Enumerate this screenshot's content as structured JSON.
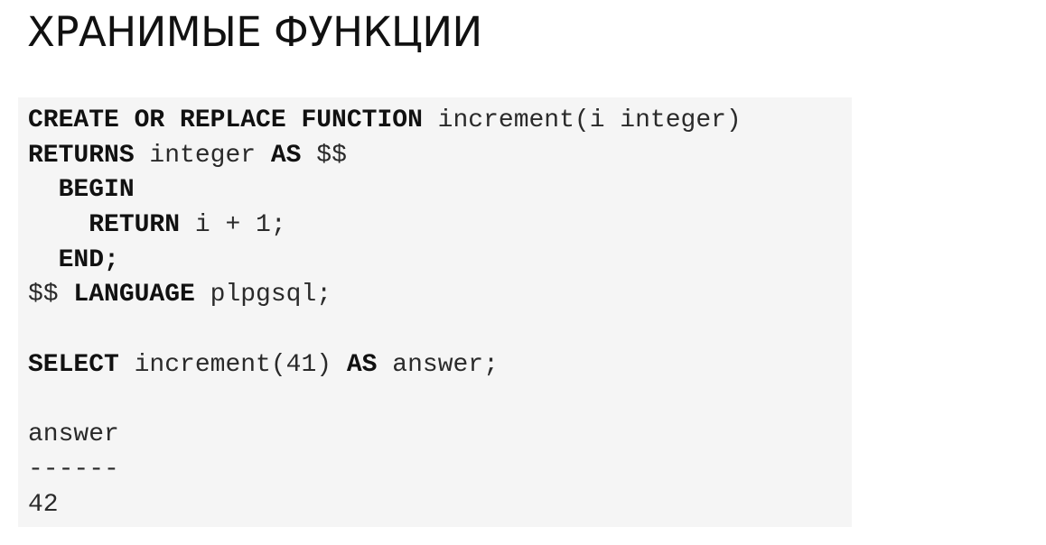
{
  "slide": {
    "title": "ХРАНИМЫЕ ФУНКЦИИ"
  },
  "code": {
    "lines": [
      [
        {
          "t": "CREATE OR REPLACE FUNCTION",
          "kw": true
        },
        {
          "t": " increment(i integer)",
          "kw": false
        }
      ],
      [
        {
          "t": "RETURNS",
          "kw": true
        },
        {
          "t": " integer ",
          "kw": false
        },
        {
          "t": "AS",
          "kw": true
        },
        {
          "t": " $$",
          "kw": false
        }
      ],
      [
        {
          "t": "  ",
          "kw": false
        },
        {
          "t": "BEGIN",
          "kw": true
        }
      ],
      [
        {
          "t": "    ",
          "kw": false
        },
        {
          "t": "RETURN",
          "kw": true
        },
        {
          "t": " i + 1;",
          "kw": false
        }
      ],
      [
        {
          "t": "  ",
          "kw": false
        },
        {
          "t": "END;",
          "kw": true
        }
      ],
      [
        {
          "t": "$$ ",
          "kw": false
        },
        {
          "t": "LANGUAGE",
          "kw": true
        },
        {
          "t": " plpgsql;",
          "kw": false
        }
      ],
      [],
      [
        {
          "t": "SELECT",
          "kw": true
        },
        {
          "t": " increment(41) ",
          "kw": false
        },
        {
          "t": "AS",
          "kw": true
        },
        {
          "t": " answer;",
          "kw": false
        }
      ],
      [],
      [
        {
          "t": "answer",
          "kw": false
        }
      ],
      [
        {
          "t": "------",
          "kw": false
        }
      ],
      [
        {
          "t": "42",
          "kw": false
        }
      ]
    ]
  }
}
